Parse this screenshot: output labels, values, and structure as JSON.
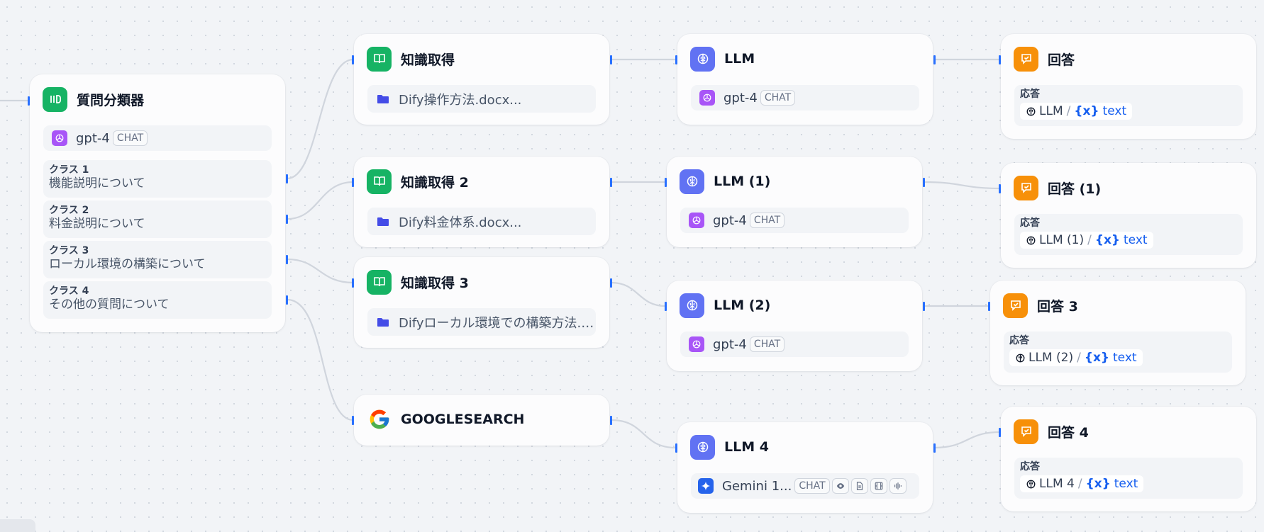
{
  "classifier": {
    "title": "質問分類器",
    "model": "gpt-4",
    "model_tag": "CHAT",
    "classes": [
      {
        "label": "クラス 1",
        "text": "機能説明について"
      },
      {
        "label": "クラス 2",
        "text": "料金説明について"
      },
      {
        "label": "クラス 3",
        "text": "ローカル環境の構築について"
      },
      {
        "label": "クラス 4",
        "text": "その他の質問について"
      }
    ]
  },
  "knowledge": [
    {
      "title": "知識取得",
      "dataset": "Dify操作方法.docx..."
    },
    {
      "title": "知識取得 2",
      "dataset": "Dify料金体系.docx..."
    },
    {
      "title": "知識取得 3",
      "dataset": "Difyローカル環境での構築方法.d..."
    }
  ],
  "google": {
    "title": "GOOGLESEARCH"
  },
  "llms": [
    {
      "title": "LLM",
      "model": "gpt-4",
      "tag": "CHAT"
    },
    {
      "title": "LLM (1)",
      "model": "gpt-4",
      "tag": "CHAT"
    },
    {
      "title": "LLM (2)",
      "model": "gpt-4",
      "tag": "CHAT"
    },
    {
      "title": "LLM 4",
      "model": "Gemini 1...",
      "tag": "CHAT"
    }
  ],
  "answers": [
    {
      "title": "回答",
      "label": "応答",
      "source": "LLM",
      "variable": "text"
    },
    {
      "title": "回答 (1)",
      "label": "応答",
      "source": "LLM (1)",
      "variable": "text"
    },
    {
      "title": "回答 3",
      "label": "応答",
      "source": "LLM (2)",
      "variable": "text"
    },
    {
      "title": "回答 4",
      "label": "応答",
      "source": "LLM 4",
      "variable": "text"
    }
  ],
  "var_symbol": "{x}",
  "separator": "/",
  "colors": {
    "knowledge_icon": "#16b364",
    "llm_icon": "#6172f3",
    "answer_icon": "#f79009",
    "model_icon": "#a855f7",
    "edge": "#d0d5dd",
    "handle": "#2970ff",
    "variable": "#155eef"
  },
  "icons": {
    "classifier": "question-classifier-icon",
    "knowledge": "book-icon",
    "llm": "llm-brain-icon",
    "answer": "answer-check-icon",
    "openai": "openai-icon",
    "gemini": "gemini-icon",
    "google": "google-icon",
    "dataset": "folder-icon",
    "features": [
      "vision-eye-icon",
      "document-icon",
      "video-icon",
      "audio-icon"
    ]
  }
}
